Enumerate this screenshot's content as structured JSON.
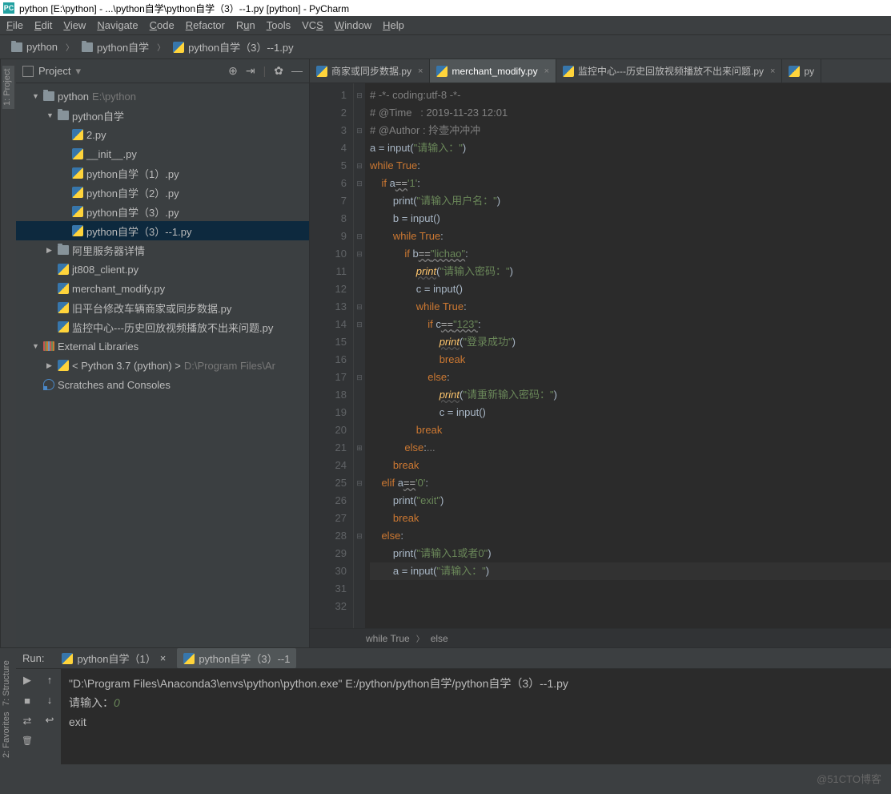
{
  "title": "python [E:\\python] - ...\\python自学\\python自学（3）--1.py [python] - PyCharm",
  "menu": [
    "File",
    "Edit",
    "View",
    "Navigate",
    "Code",
    "Refactor",
    "Run",
    "Tools",
    "VCS",
    "Window",
    "Help"
  ],
  "breadcrumbs": [
    {
      "icon": "folder",
      "label": "python"
    },
    {
      "icon": "folder",
      "label": "python自学"
    },
    {
      "icon": "py",
      "label": "python自学（3）--1.py"
    }
  ],
  "left_tabs": [
    "1: Project"
  ],
  "project_panel": {
    "title": "Project"
  },
  "tree": [
    {
      "d": 0,
      "a": "▼",
      "i": "folder",
      "t": "python",
      "x": "E:\\python"
    },
    {
      "d": 1,
      "a": "▼",
      "i": "folder",
      "t": "python自学",
      "x": ""
    },
    {
      "d": 2,
      "a": "",
      "i": "py",
      "t": "2.py"
    },
    {
      "d": 2,
      "a": "",
      "i": "py",
      "t": "__init__.py"
    },
    {
      "d": 2,
      "a": "",
      "i": "py",
      "t": "python自学（1）.py"
    },
    {
      "d": 2,
      "a": "",
      "i": "py",
      "t": "python自学（2）.py"
    },
    {
      "d": 2,
      "a": "",
      "i": "py",
      "t": "python自学（3）.py"
    },
    {
      "d": 2,
      "a": "",
      "i": "py",
      "t": "python自学（3）--1.py",
      "sel": true
    },
    {
      "d": 1,
      "a": "▶",
      "i": "folder",
      "t": "阿里服务器详情"
    },
    {
      "d": 1,
      "a": "",
      "i": "py",
      "t": "jt808_client.py"
    },
    {
      "d": 1,
      "a": "",
      "i": "py",
      "t": "merchant_modify.py"
    },
    {
      "d": 1,
      "a": "",
      "i": "py",
      "t": "旧平台修改车辆商家或同步数据.py"
    },
    {
      "d": 1,
      "a": "",
      "i": "py",
      "t": "监控中心---历史回放视频播放不出来问题.py"
    },
    {
      "d": 0,
      "a": "▼",
      "i": "lib",
      "t": "External Libraries"
    },
    {
      "d": 1,
      "a": "▶",
      "i": "py",
      "t": "< Python 3.7 (python) >",
      "x": "D:\\Program Files\\Ar"
    },
    {
      "d": 0,
      "a": "",
      "i": "scratch",
      "t": "Scratches and Consoles"
    }
  ],
  "editor_tabs": [
    {
      "label": "商家或同步数据.py",
      "active": false
    },
    {
      "label": "merchant_modify.py",
      "active": true
    },
    {
      "label": "监控中心---历史回放视频播放不出来问题.py",
      "active": false
    },
    {
      "label": "py",
      "active": false,
      "tail": true
    }
  ],
  "code": {
    "lines": [
      1,
      2,
      3,
      4,
      5,
      6,
      7,
      8,
      9,
      10,
      11,
      12,
      13,
      14,
      15,
      16,
      17,
      18,
      19,
      20,
      21,
      24,
      25,
      26,
      27,
      28,
      29,
      30,
      31,
      32
    ],
    "fold": [
      "⊟",
      "",
      "⊟",
      "",
      "⊟",
      "⊟",
      "",
      "",
      "⊟",
      "⊟",
      "",
      "",
      "⊟",
      "⊟",
      "",
      "",
      "⊟",
      "",
      "",
      "",
      "⊞",
      "",
      "⊟",
      "",
      "",
      "⊟",
      "",
      "",
      "",
      ""
    ],
    "src": {
      "l1": "# -*- coding:utf-8 -*-",
      "l2": "# @Time   : 2019-11-23 12:01",
      "l3": "# @Author : 拎壶冲冲冲",
      "l4a": "a = input(",
      "l4b": "\"请输入：\"",
      "l4c": ")",
      "l5": "while True:",
      "l6a": "    if a",
      "l6b": "==",
      "l6c": "'1':",
      "l7a": "        print(",
      "l7b": "\"请输入用户名：\"",
      "l7c": ")",
      "l8": "        b = input()",
      "l9": "        while True:",
      "l10a": "            if b",
      "l10b": "==",
      "l10c": "\"lichao\"",
      "l11a": "                print(",
      "l11b": "\"请输入密码：\"",
      "l11c": ")",
      "l12": "                c = input()",
      "l13": "                while True:",
      "l14a": "                    if c",
      "l14b": "==",
      "l14c": "\"123\"",
      "l15a": "                        print(",
      "l15b": "\"登录成功\"",
      "l15c": ")",
      "l16": "                        break",
      "l17": "                    else:",
      "l18a": "                        print(",
      "l18b": "\"请重新输入密码：\"",
      "l18c": ")",
      "l19": "                        c = input()",
      "l20": "                break",
      "l21": "            else:...",
      "l24": "        break",
      "l25a": "    elif a",
      "l25b": "==",
      "l25c": "'0':",
      "l26a": "        print(",
      "l26b": "\"exit\"",
      "l26c": ")",
      "l27": "        break",
      "l28": "    else:",
      "l29a": "        print(",
      "l29b": "\"请输入1或者0\"",
      "l29c": ")",
      "l30a": "        a = input(",
      "l30b": "\"请输入：\"",
      "l30c": ")"
    }
  },
  "bc_bottom": [
    "while True",
    "else"
  ],
  "run": {
    "label": "Run:",
    "tabs": [
      {
        "label": "python自学（1）",
        "active": false
      },
      {
        "label": "python自学（3）--1",
        "active": true
      }
    ],
    "console_lines": [
      "\"D:\\Program Files\\Anaconda3\\envs\\python\\python.exe\" E:/python/python自学/python自学（3）--1.py",
      "请输入：0",
      "exit"
    ]
  },
  "left_bottom_tabs": [
    "2: Favorites",
    "7: Structure"
  ],
  "watermark": "@51CTO博客"
}
